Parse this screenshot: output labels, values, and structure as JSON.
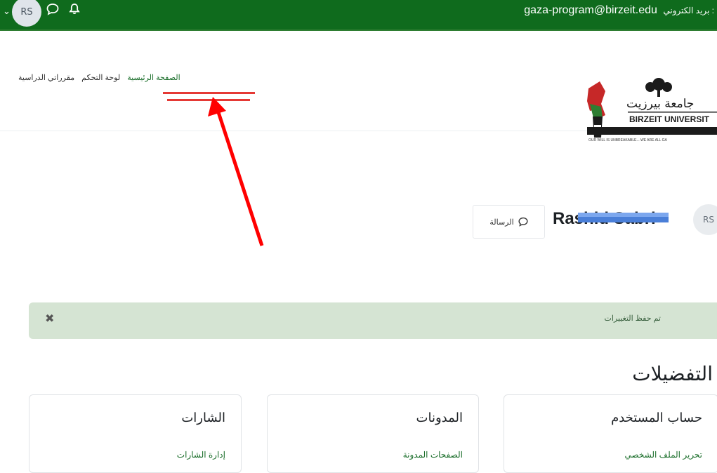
{
  "topbar": {
    "avatar_initials": "RS",
    "email": "gaza-program@birzeit.edu",
    "email_label": "بريد الكتروني :",
    "icons": [
      "chevron-down-icon",
      "chat-bubble-icon",
      "bell-icon"
    ],
    "background": "#0f6b1d"
  },
  "nav": {
    "items": [
      {
        "label": "الصفحة الرئيسية",
        "active": true
      },
      {
        "label": "لوحة التحكم",
        "active": false
      },
      {
        "label": "مقرراتي الدراسية",
        "active": false
      }
    ]
  },
  "logo": {
    "university": "BIRZEIT UNIVERSIT",
    "arabic_name": "جامعة بيرزيت",
    "tagline": "OUR WILL IS UNBREAKABLE... WE ARE ALL GA"
  },
  "profile": {
    "name": "Rashid Sabri",
    "avatar_initials": "RS",
    "message_label": "الرسالة"
  },
  "alert": {
    "text": "تم حفظ التغييرات",
    "close_symbol": "✖"
  },
  "preferences": {
    "title": "التفضيلات",
    "cards": [
      {
        "title": "حساب المستخدم",
        "link": "تحرير الملف الشخصي"
      },
      {
        "title": "المدونات",
        "link": "الصفحات المدونة"
      },
      {
        "title": "الشارات",
        "link": "إدارة الشارات"
      }
    ]
  },
  "colors": {
    "accent_green": "#1a6e2a",
    "alert_bg": "#d5e4d3",
    "annotation_red": "#e53935"
  }
}
